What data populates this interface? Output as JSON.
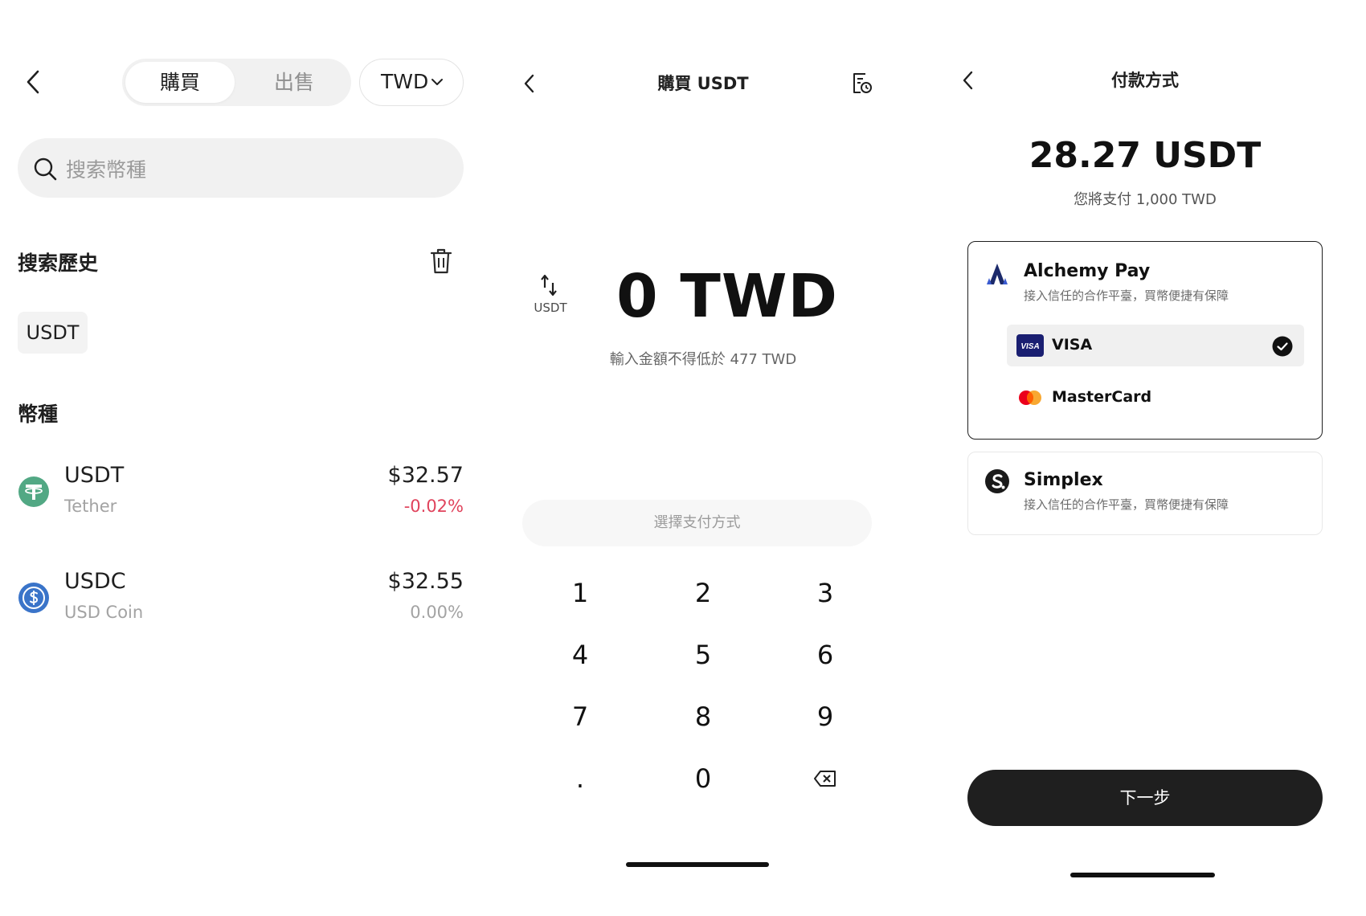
{
  "buy_list": {
    "tabs": {
      "buy": "購買",
      "sell": "出售"
    },
    "currency_select": "TWD",
    "search": {
      "placeholder": "搜索幣種"
    },
    "history": {
      "title": "搜索歷史",
      "chips": [
        "USDT"
      ]
    },
    "coins_title": "幣種",
    "coins": [
      {
        "symbol": "USDT",
        "name": "Tether",
        "price": "$32.57",
        "change": "-0.02%",
        "change_color": "#e0435c",
        "icon_color": "#52a884"
      },
      {
        "symbol": "USDC",
        "name": "USD Coin",
        "price": "$32.55",
        "change": "0.00%",
        "change_color": "#a3a3a3",
        "icon_color": "#3a74c9"
      }
    ]
  },
  "buy_amount": {
    "title": "購買 USDT",
    "swap_label": "USDT",
    "amount": "0 TWD",
    "min_note": "輸入金額不得低於 477 TWD",
    "pay_method_button": "選擇支付方式",
    "keypad": [
      "1",
      "2",
      "3",
      "4",
      "5",
      "6",
      "7",
      "8",
      "9",
      ".",
      "0",
      "backspace"
    ]
  },
  "payment": {
    "title": "付款方式",
    "amount": "28.27 USDT",
    "note": "您將支付 1,000 TWD",
    "providers": [
      {
        "name": "Alchemy Pay",
        "desc": "接入信任的合作平臺，買幣便捷有保障",
        "selected": true,
        "methods": [
          {
            "name": "VISA",
            "selected": true,
            "badge": "VISA"
          },
          {
            "name": "MasterCard",
            "selected": false
          }
        ]
      },
      {
        "name": "Simplex",
        "desc": "接入信任的合作平臺，買幣便捷有保障",
        "selected": false
      }
    ],
    "next_button": "下一步"
  },
  "colors": {
    "primary": "#1f1f1f",
    "negative": "#e0435c",
    "muted": "#a3a3a3",
    "alchemy": "#1c2a6b",
    "visa": "#1a1f71"
  }
}
